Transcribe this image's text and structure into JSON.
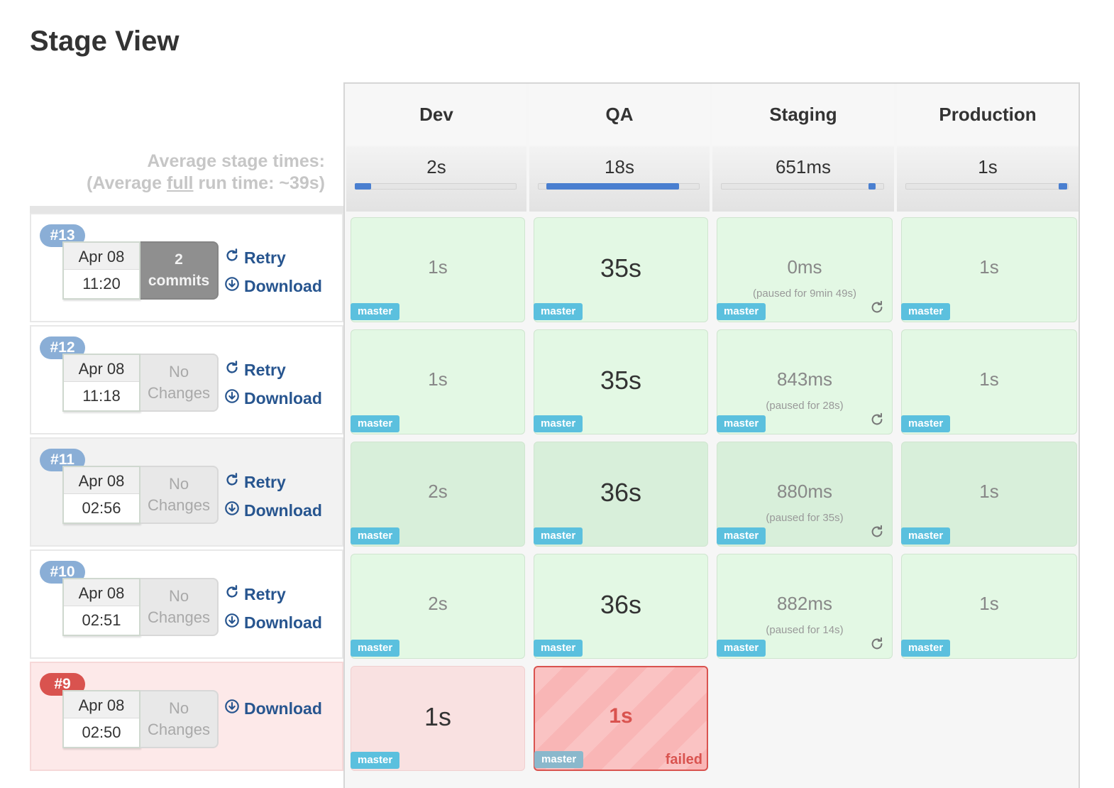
{
  "page": {
    "title": "Stage View"
  },
  "average": {
    "line1": "Average stage times:",
    "line2_prefix": "(Average ",
    "line2_underlined": "full",
    "line2_suffix": " run time: ~39s)"
  },
  "stages": [
    {
      "name": "Dev",
      "avg": "2s",
      "avg_fraction": 0.1
    },
    {
      "name": "QA",
      "avg": "18s",
      "avg_fraction": 0.82
    },
    {
      "name": "Staging",
      "avg": "651ms",
      "avg_fraction": 0.03
    },
    {
      "name": "Production",
      "avg": "1s",
      "avg_fraction": 0.05
    }
  ],
  "actions": {
    "retry": "Retry",
    "download": "Download"
  },
  "runs": [
    {
      "id": "#13",
      "date": "Apr 08",
      "time": "11:20",
      "changes_line1": "2",
      "changes_line2": "commits",
      "cells": [
        {
          "value": "1s",
          "branch": "master"
        },
        {
          "value": "35s",
          "branch": "master"
        },
        {
          "value": "0ms",
          "paused": "(paused for 9min 49s)",
          "branch": "master"
        },
        {
          "value": "1s",
          "branch": "master"
        }
      ]
    },
    {
      "id": "#12",
      "date": "Apr 08",
      "time": "11:18",
      "changes_line1": "No",
      "changes_line2": "Changes",
      "cells": [
        {
          "value": "1s",
          "branch": "master"
        },
        {
          "value": "35s",
          "branch": "master"
        },
        {
          "value": "843ms",
          "paused": "(paused for 28s)",
          "branch": "master"
        },
        {
          "value": "1s",
          "branch": "master"
        }
      ]
    },
    {
      "id": "#11",
      "date": "Apr 08",
      "time": "02:56",
      "changes_line1": "No",
      "changes_line2": "Changes",
      "cells": [
        {
          "value": "2s",
          "branch": "master"
        },
        {
          "value": "36s",
          "branch": "master"
        },
        {
          "value": "880ms",
          "paused": "(paused for 35s)",
          "branch": "master"
        },
        {
          "value": "1s",
          "branch": "master"
        }
      ]
    },
    {
      "id": "#10",
      "date": "Apr 08",
      "time": "02:51",
      "changes_line1": "No",
      "changes_line2": "Changes",
      "cells": [
        {
          "value": "2s",
          "branch": "master"
        },
        {
          "value": "36s",
          "branch": "master"
        },
        {
          "value": "882ms",
          "paused": "(paused for 14s)",
          "branch": "master"
        },
        {
          "value": "1s",
          "branch": "master"
        }
      ]
    },
    {
      "id": "#9",
      "date": "Apr 08",
      "time": "02:50",
      "changes_line1": "No",
      "changes_line2": "Changes",
      "cells": [
        {
          "value": "1s",
          "branch": "master"
        },
        {
          "value": "1s",
          "branch": "master",
          "status": "failed"
        }
      ]
    }
  ],
  "colors": {
    "success": "#e3f8e4",
    "failed": "#d9534f",
    "branch": "#5bc0de",
    "link": "#27558f",
    "bar": "#4a7fd0"
  }
}
